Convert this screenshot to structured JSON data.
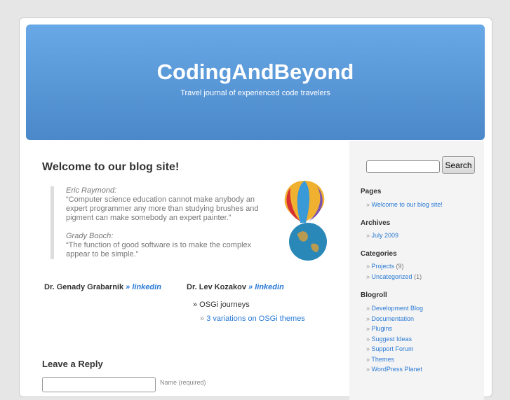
{
  "header": {
    "title": "CodingAndBeyond",
    "description": "Travel journal of experienced code travelers"
  },
  "post": {
    "title": "Welcome to our blog site!",
    "quotes": [
      {
        "author": "Eric Raymond:",
        "text": "“Computer science education cannot make anybody an expert programmer any more than studying brushes and pigment can make somebody an expert painter.”"
      },
      {
        "author": "Grady Booch:",
        "text": "“The function of good software is to make the complex appear to be simple.”"
      }
    ],
    "authors": [
      {
        "name": "Dr. Genady Grabarnik",
        "link": "» linkedin"
      },
      {
        "name": "Dr. Lev Kozakov",
        "link": "» linkedin"
      }
    ],
    "list": {
      "item": "» OSGi journeys",
      "subitem": "3 variations on OSGi themes"
    }
  },
  "reply": {
    "title": "Leave a Reply",
    "name_label": "Name (required)"
  },
  "sidebar": {
    "search_button": "Search",
    "pages": {
      "title": "Pages",
      "items": [
        "Welcome to our blog site!"
      ]
    },
    "archives": {
      "title": "Archives",
      "items": [
        "July 2009"
      ]
    },
    "categories": {
      "title": "Categories",
      "items": [
        {
          "label": "Projects",
          "count": "(9)"
        },
        {
          "label": "Uncategorized",
          "count": "(1)"
        }
      ]
    },
    "blogroll": {
      "title": "Blogroll",
      "items": [
        "Development Blog",
        "Documentation",
        "Plugins",
        "Suggest Ideas",
        "Support Forum",
        "Themes",
        "WordPress Planet"
      ]
    }
  }
}
